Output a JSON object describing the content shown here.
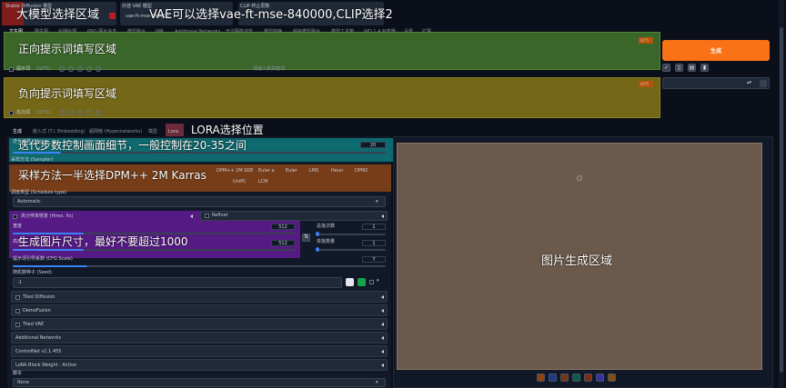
{
  "header": {
    "model_label": "Stable Diffusion 模型",
    "model_value": "",
    "vae_label": "外挂 VAE 模型",
    "vae_value": "vae-ft-mse-840000",
    "clip_label": "CLIP 终止层数",
    "clip_value": "2"
  },
  "main_tabs": [
    "文生图",
    "图生图",
    "后期处理",
    "PNG 图片信息",
    "模型融合",
    "训练",
    "Additional Networks",
    "无边图像浏览",
    "模型转换",
    "超级模型融合",
    "模型工具箱",
    "WD 1.4 标签器",
    "设置",
    "扩展"
  ],
  "prompt": {
    "positive_token_count": "0/75",
    "negative_token_count": "0/75",
    "positive_label": "提示词",
    "negative_label": "反向词",
    "positive_counter": "(0/75)",
    "negative_counter": "(0/75)",
    "hint": "请输入新关键词"
  },
  "generate_button": "生成",
  "sub_tabs": [
    "生成",
    "嵌入式 (T.I. Embedding)",
    "超网络 (Hypernetworks)",
    "模型",
    "Lora"
  ],
  "steps": {
    "label": "迭代步数 (Steps)",
    "value": "20",
    "fraction": 0.13
  },
  "sampler": {
    "label": "采样方法 (Sampler)",
    "options": [
      "DPM++ 2M SDE",
      "Euler a",
      "Euler",
      "LMS",
      "Heun",
      "DPM2",
      "UniPC",
      "LCM"
    ],
    "selected": "DPM++ 2M Karras"
  },
  "schedule": {
    "label": "调度类型 (Schedule type)",
    "value": "Automatic"
  },
  "hires": {
    "label": "高分辨率修复 (Hires. fix)"
  },
  "refiner": {
    "label": "Refiner"
  },
  "width": {
    "label": "宽度",
    "value": "512",
    "fraction": 0.25
  },
  "height": {
    "label": "高度",
    "value": "512",
    "fraction": 0.25
  },
  "batch_count": {
    "label": "总批次数",
    "value": "1"
  },
  "batch_size": {
    "label": "单批数量",
    "value": "1"
  },
  "cfg": {
    "label": "提示词引导系数 (CFG Scale)",
    "value": "7",
    "fraction": 0.2
  },
  "seed": {
    "label": "随机数种子 (Seed)",
    "value": "-1"
  },
  "extensions": [
    {
      "label": "Tiled Diffusion",
      "checkbox": true
    },
    {
      "label": "DemoFusion",
      "checkbox": true
    },
    {
      "label": "Tiled VAE",
      "checkbox": true
    },
    {
      "label": "Additional Networks",
      "checkbox": false
    },
    {
      "label": "ControlNet v1.1.455",
      "checkbox": false
    },
    {
      "label": "LoRA Block Weight : Active",
      "checkbox": false
    }
  ],
  "script": {
    "label": "脚本",
    "value": "None"
  },
  "annotations": {
    "model": "大模型选择区域",
    "vae": "VAE可以选择vae-ft-mse-840000,CLIP选择2",
    "positive": "正向提示词填写区域",
    "negative": "负向提示词填写区域",
    "lora": "LORA选择位置",
    "steps": "迭代步数控制画面细节，一般控制在20-35之间",
    "sampler": "采样方法一半选择DPM++ 2M Karras",
    "size": "生成图片尺寸，最好不要超过1000",
    "output": "图片生成区域"
  },
  "colors": {
    "generate": "#f97316",
    "positive_overlay": "#4a7a32",
    "negative_overlay": "#8a7a1a",
    "steps_overlay": "#0f7a7a",
    "sampler_overlay": "#8a4a1a",
    "size_overlay": "#6a1a9a",
    "output_overlay": "#6b5a4c"
  },
  "toolbar_icons": [
    "folder-icon",
    "save-icon",
    "zip-icon",
    "image-icon",
    "paint-icon",
    "upscale-icon",
    "star-icon"
  ]
}
